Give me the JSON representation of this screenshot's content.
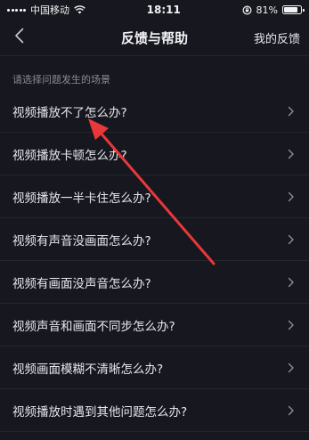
{
  "status_bar": {
    "carrier": "中国移动",
    "time": "18:11",
    "battery_percent": "81%",
    "battery_level": 0.81
  },
  "header": {
    "title": "反馈与帮助",
    "my_feedback": "我的反馈",
    "back_icon": "chevron-left-icon"
  },
  "section_label": "请选择问题发生的场景",
  "faq": [
    {
      "label": "视频播放不了怎么办?"
    },
    {
      "label": "视频播放卡顿怎么办?"
    },
    {
      "label": "视频播放一半卡住怎么办?"
    },
    {
      "label": "视频有声音没画面怎么办?"
    },
    {
      "label": "视频有画面没声音怎么办?"
    },
    {
      "label": "视频声音和画面不同步怎么办?"
    },
    {
      "label": "视频画面模糊不清晰怎么办?"
    },
    {
      "label": "视频播放时遇到其他问题怎么办?"
    }
  ],
  "colors": {
    "background": "#17171f",
    "annotation_arrow": "#e8383a"
  }
}
